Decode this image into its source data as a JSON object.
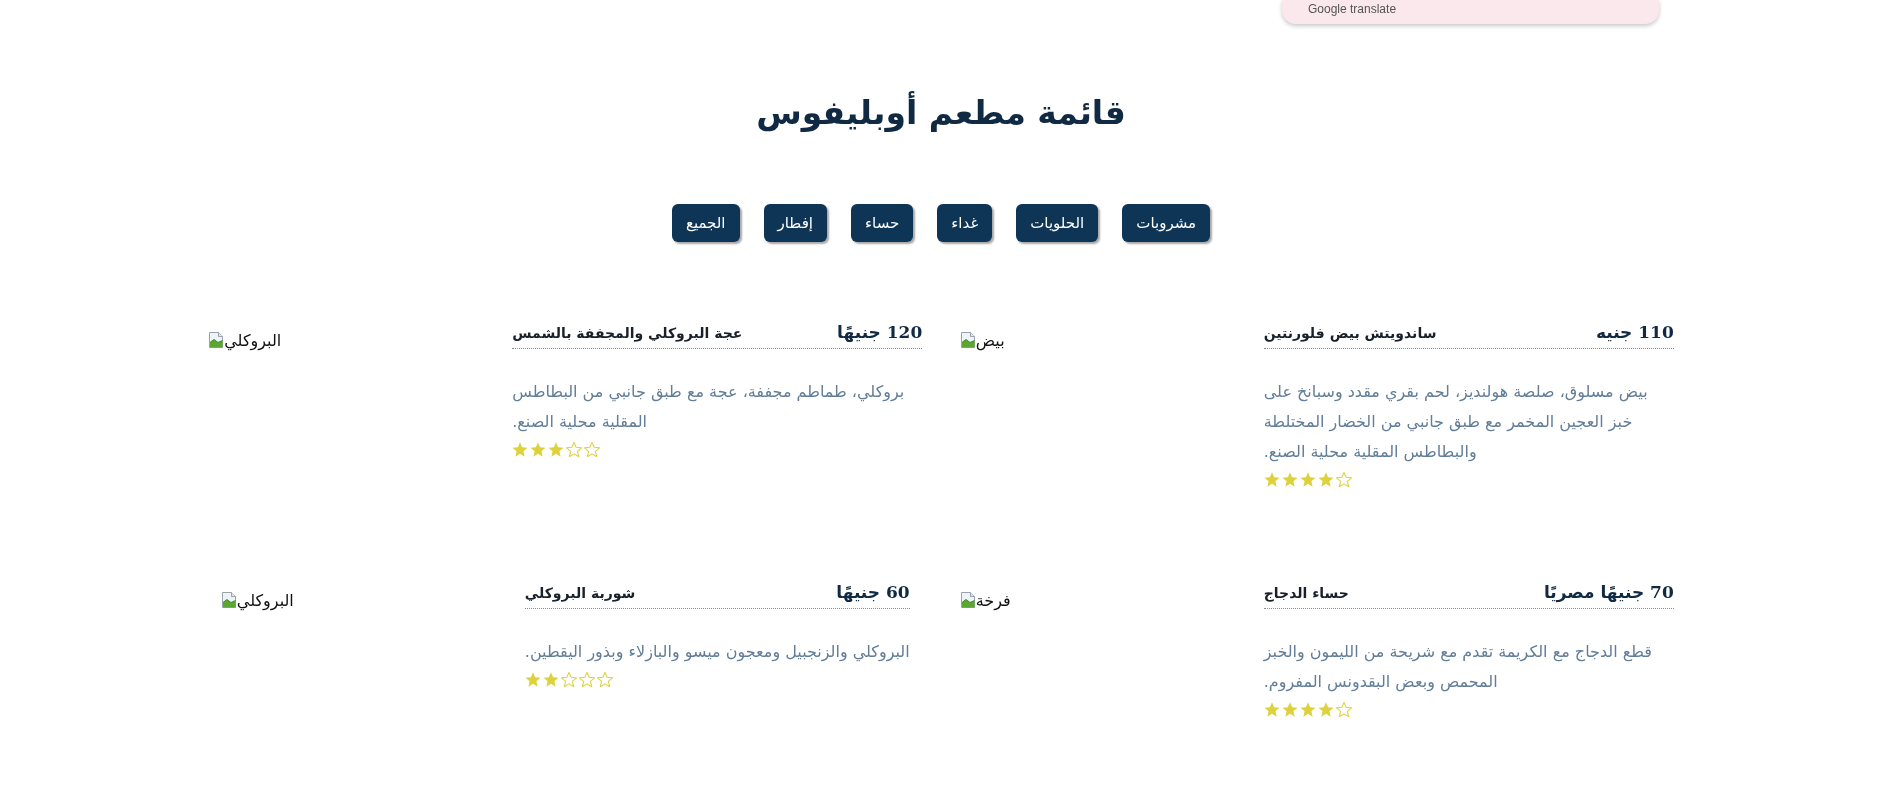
{
  "translate_popup": {
    "text": "Google translate"
  },
  "title": "قائمة مطعم أوبليفوس",
  "filters": [
    {
      "label": "مشروبات"
    },
    {
      "label": "الحلويات"
    },
    {
      "label": "غداء"
    },
    {
      "label": "حساء"
    },
    {
      "label": "إفطار"
    },
    {
      "label": "الجميع"
    }
  ],
  "items": [
    {
      "image_alt": "بيض",
      "name": "ساندويتش بيض فلورنتين",
      "price": "110 جنيه",
      "description": "بيض مسلوق، صلصة هولنديز، لحم بقري مقدد وسبانخ على خبز العجين المخمر مع طبق جانبي من الخضار المختلطة والبطاطس المقلية محلية الصنع.",
      "stars": 4
    },
    {
      "image_alt": "البروكلي",
      "name": "عجة البروكلي والمجففة بالشمس",
      "price": "120 جنيهًا",
      "description": "بروكلي، طماطم مجففة، عجة مع طبق جانبي من البطاطس المقلية محلية الصنع.",
      "stars": 3
    },
    {
      "image_alt": "فرخة",
      "name": "حساء الدجاج",
      "price": "70 جنيهًا مصريًا",
      "description": "قطع الدجاج مع الكريمة تقدم مع شريحة من الليمون والخبز المحمص وبعض البقدونس المفروم.",
      "stars": 4
    },
    {
      "image_alt": "البروكلي",
      "name": "شوربة البروكلي",
      "price": "60 جنيهًا",
      "description": "البروكلي والزنجبيل ومعجون ميسو والبازلاء وبذور اليقطين.",
      "stars": 2
    }
  ]
}
